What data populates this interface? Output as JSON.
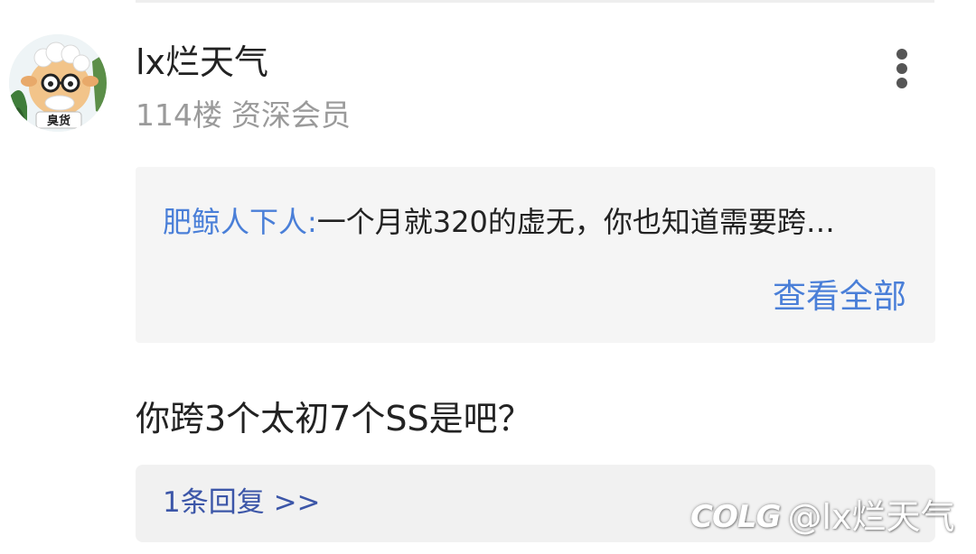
{
  "post": {
    "username": "lx烂天气",
    "floor": "114楼",
    "member_level": "资深会员",
    "avatar_badge_text": "臭货",
    "more_icon": "more-vertical-icon",
    "quote": {
      "author": "肥鲸人下人:",
      "text": "一个月就320的虚无，你也知道需要跨…",
      "view_all_label": "查看全部"
    },
    "body": "你跨3个太初7个SS是吧？",
    "reply_link": "1条回复 >>"
  },
  "watermark": {
    "logo": "COLG",
    "handle": "@lx烂天气"
  },
  "colors": {
    "link_blue": "#4a7fd8",
    "reply_blue": "#3c56a8",
    "quote_background": "#f5f5f5",
    "reply_background": "#f1f1f1",
    "meta_gray": "#9a9a9a"
  }
}
